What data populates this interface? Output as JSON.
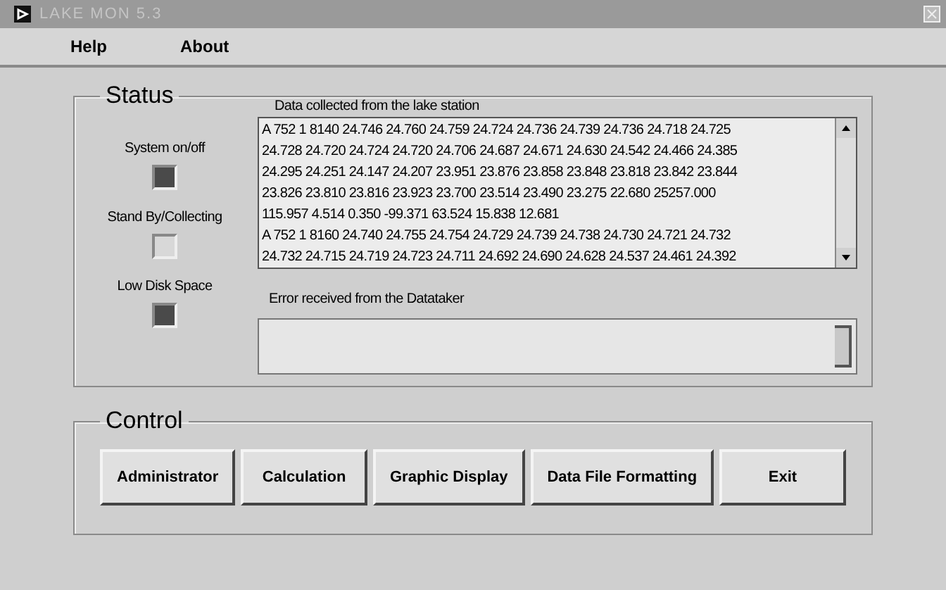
{
  "window": {
    "title": "LAKE MON 5.3"
  },
  "menu": [
    "Help",
    "About"
  ],
  "status": {
    "title": "Status",
    "indicators": [
      {
        "label": "System on/off",
        "on": false
      },
      {
        "label": "Stand By/Collecting",
        "on": true
      },
      {
        "label": "Low Disk Space",
        "on": false
      }
    ],
    "data_box": {
      "label": "Data collected from the lake station",
      "lines": [
        "A 752 1 8140 24.746 24.760 24.759 24.724 24.736 24.739 24.736 24.718 24.725",
        "24.728 24.720 24.724 24.720 24.706 24.687 24.671 24.630 24.542 24.466 24.385",
        "24.295 24.251 24.147 24.207 23.951 23.876 23.858 23.848 23.818 23.842 23.844",
        "23.826 23.810 23.816 23.923 23.700 23.514 23.490 23.275 22.680 25257.000",
        "115.957 4.514 0.350 -99.371 63.524 15.838 12.681",
        "A 752 1 8160 24.740 24.755 24.754 24.729 24.739 24.738 24.730 24.721 24.732",
        "24.732 24.715 24.719 24.723 24.711 24.692 24.690 24.628 24.537 24.461 24.392"
      ]
    },
    "error_box": {
      "label": "Error received from the Datataker"
    }
  },
  "control": {
    "title": "Control",
    "buttons": [
      "Administrator",
      "Calculation",
      "Graphic Display",
      "Data File Formatting",
      "Exit"
    ]
  }
}
